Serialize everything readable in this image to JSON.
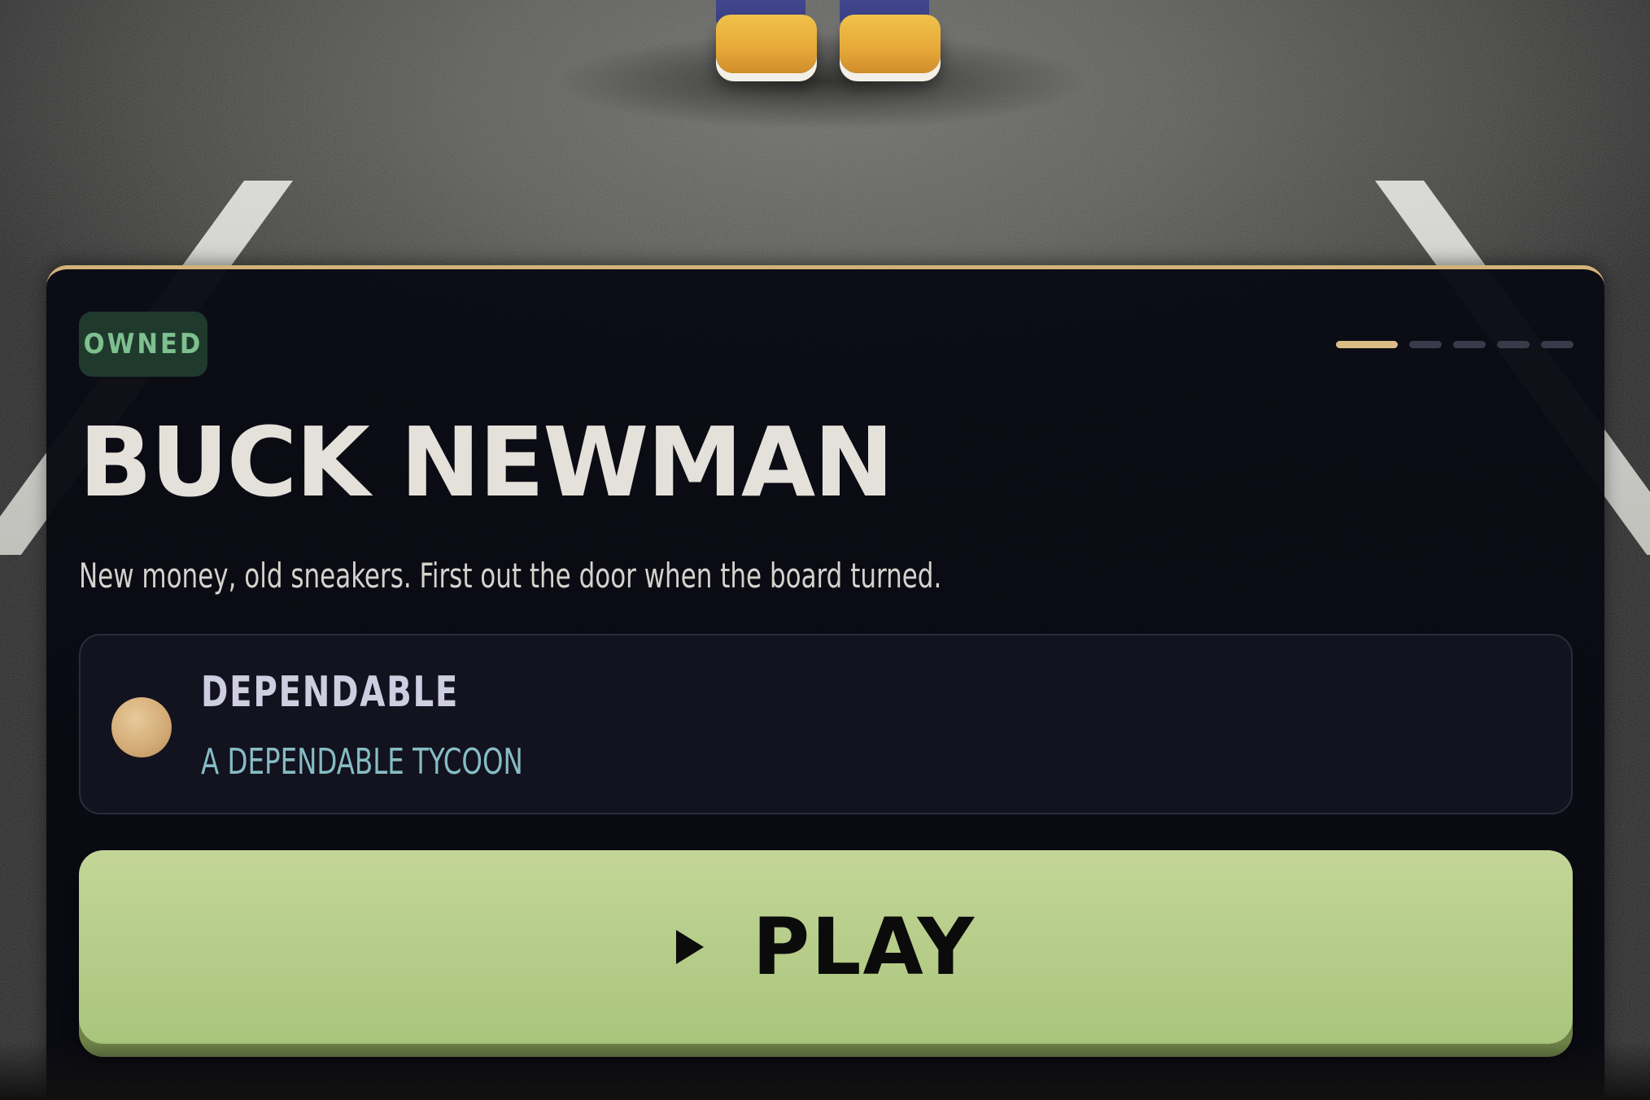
{
  "character": {
    "badge": "OWNED",
    "name": "BUCK NEWMAN",
    "tagline": "New money, old sneakers. First out the door when the board turned.",
    "trait": {
      "title": "DEPENDABLE",
      "subtitle": "A DEPENDABLE TYCOON",
      "icon": "trait-orb"
    }
  },
  "pager": {
    "total": 5,
    "active_index": 0
  },
  "actions": {
    "play_label": "PLAY",
    "play_icon": "play-triangle-icon"
  },
  "colors": {
    "accent_gold": "#d2b27a",
    "badge_bg": "#1f3a2d",
    "badge_text": "#7ec08f",
    "play_button": "#b6cd88",
    "trait_subtitle": "#86bcc4"
  }
}
